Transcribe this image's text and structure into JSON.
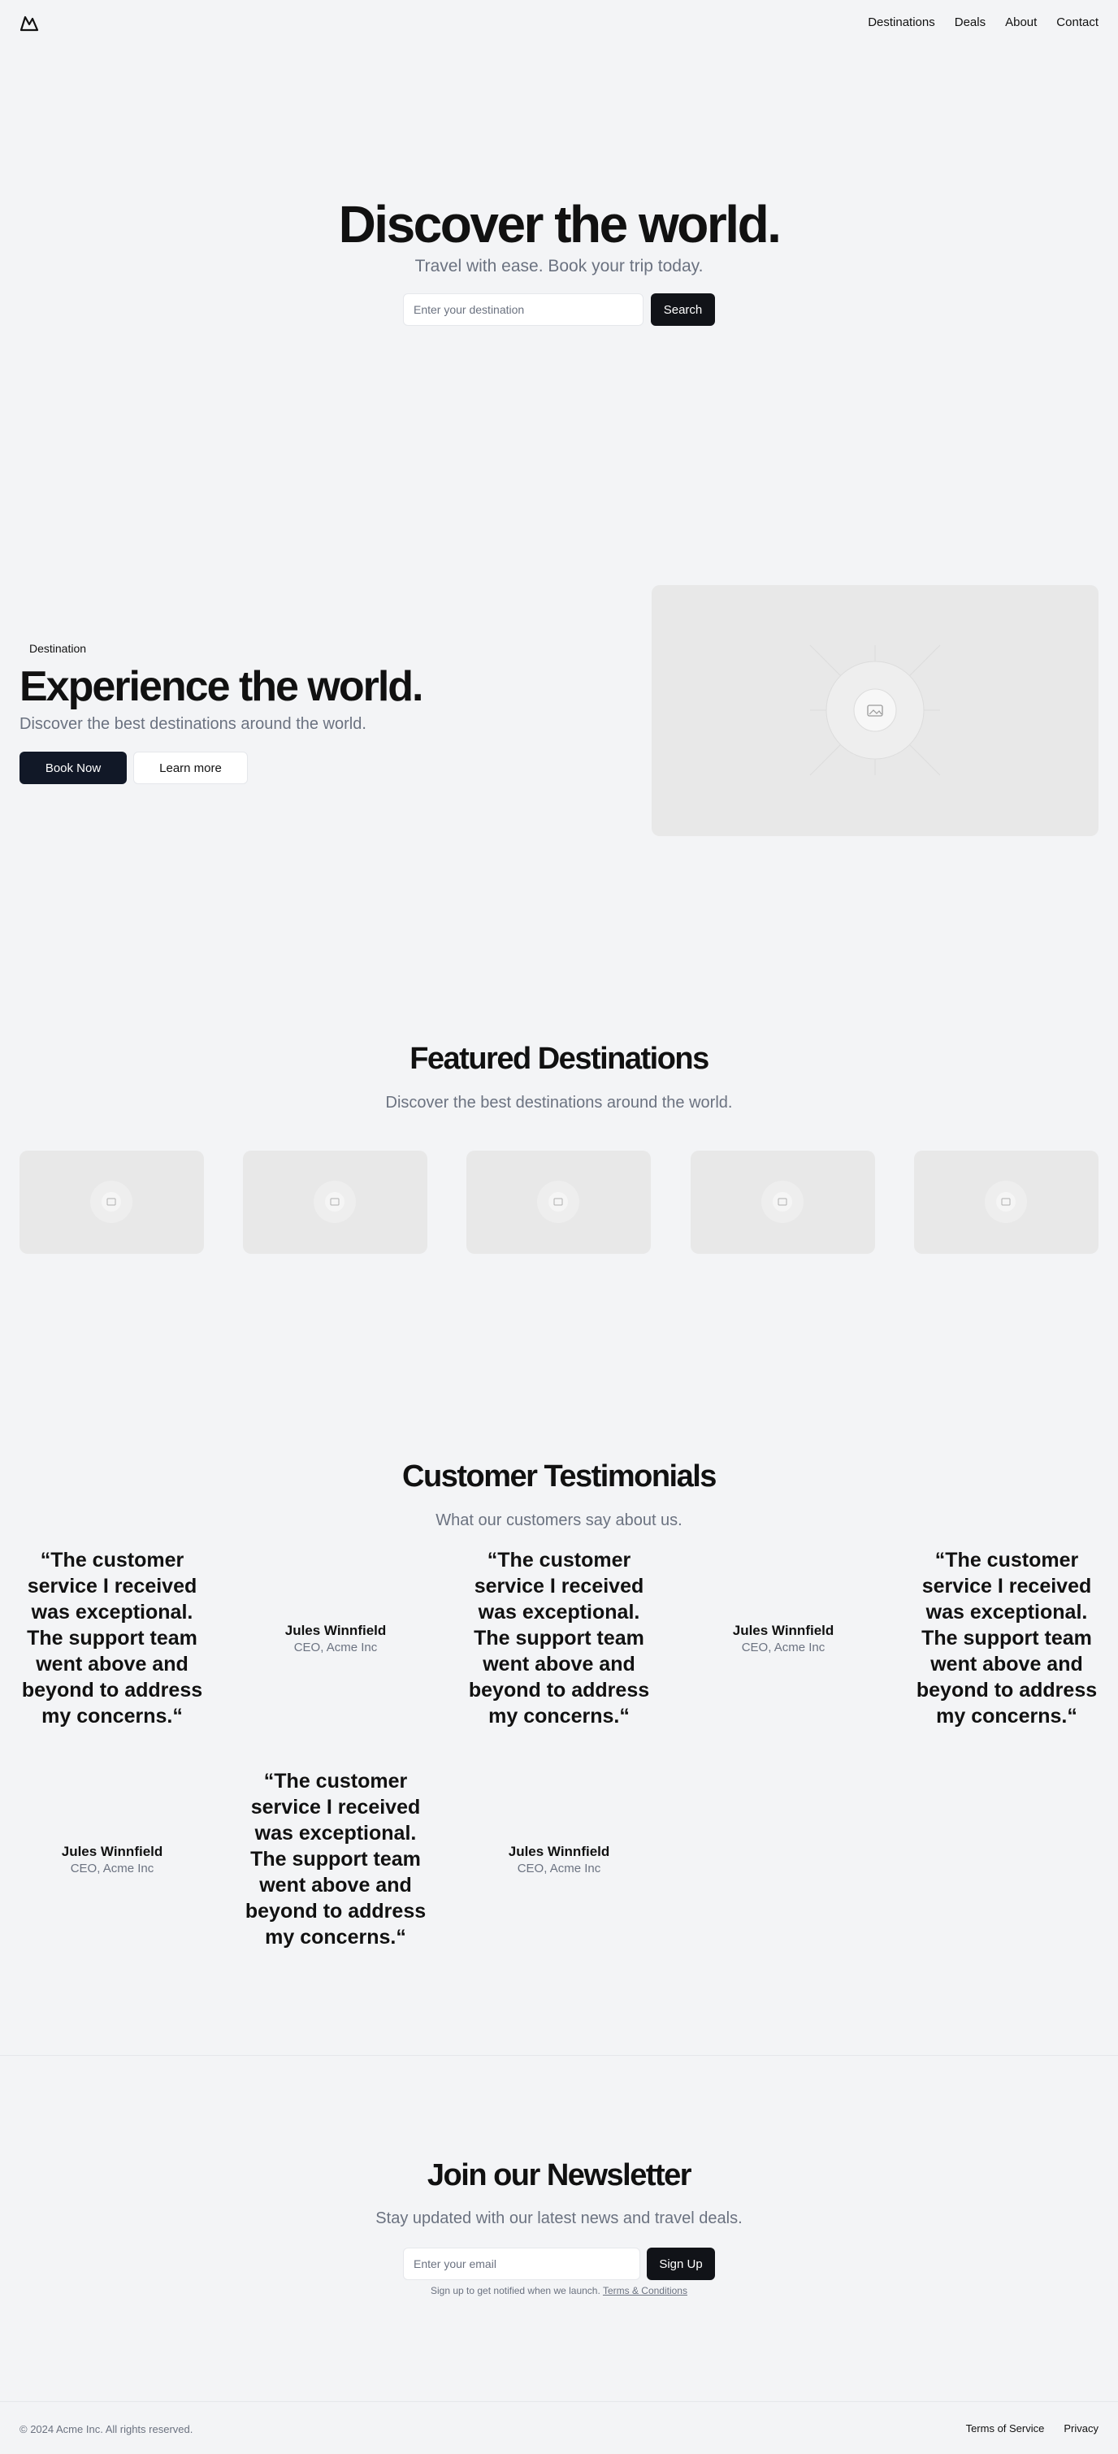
{
  "header": {
    "logo_icon": "mountain-icon",
    "nav": [
      "Destinations",
      "Deals",
      "About",
      "Contact"
    ]
  },
  "hero": {
    "title": "Discover the world.",
    "subtitle": "Travel with ease. Book your trip today.",
    "search_placeholder": "Enter your destination",
    "search_button": "Search"
  },
  "experience": {
    "badge": "Destination",
    "title": "Experience the world.",
    "subtitle": "Discover the best destinations around the world.",
    "primary_button": "Book Now",
    "secondary_button": "Learn more",
    "image_icon": "image-placeholder-icon"
  },
  "featured": {
    "title": "Featured Destinations",
    "subtitle": "Discover the best destinations around the world.",
    "card_count": 5
  },
  "testimonials": {
    "title": "Customer Testimonials",
    "subtitle": "What our customers say about us.",
    "quote": "“The customer service I received was exceptional. The support team went above and beyond to address my concerns.“",
    "name": "Jules Winnfield",
    "role": "CEO, Acme Inc"
  },
  "newsletter": {
    "title": "Join our Newsletter",
    "subtitle": "Stay updated with our latest news and travel deals.",
    "email_placeholder": "Enter your email",
    "button": "Sign Up",
    "fine_print": "Sign up to get notified when we launch.",
    "terms_link": "Terms & Conditions"
  },
  "footer": {
    "copyright": "© 2024 Acme Inc. All rights reserved.",
    "links": [
      "Terms of Service",
      "Privacy"
    ]
  },
  "colors": {
    "background": "#f3f4f6",
    "primary_button": "#111827",
    "muted_text": "#6b7280",
    "placeholder_fill": "#e8e8e8"
  }
}
